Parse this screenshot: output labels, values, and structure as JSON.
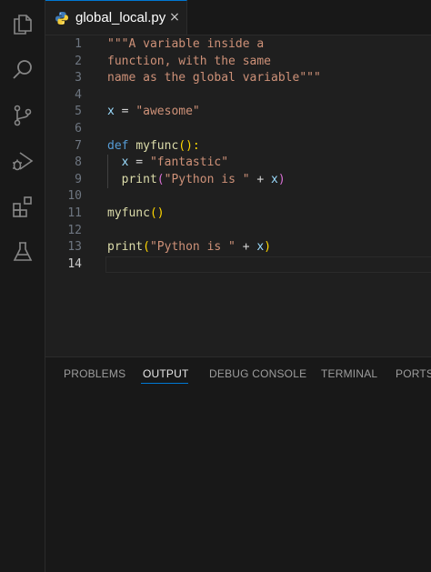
{
  "activity_bar": {
    "icons": [
      "explorer-icon",
      "search-icon",
      "source-control-icon",
      "run-debug-icon",
      "extensions-icon",
      "testing-icon"
    ]
  },
  "tab": {
    "filename": "global_local.py",
    "icon": "python-icon",
    "close": "×"
  },
  "editor": {
    "current_line": 14,
    "lines": [
      {
        "n": "1",
        "tokens": [
          {
            "t": "\"\"\"A variable inside a",
            "c": "str"
          }
        ]
      },
      {
        "n": "2",
        "tokens": [
          {
            "t": "function, with the same",
            "c": "str"
          }
        ]
      },
      {
        "n": "3",
        "tokens": [
          {
            "t": "name as the global variable\"\"\"",
            "c": "str"
          }
        ]
      },
      {
        "n": "4",
        "tokens": []
      },
      {
        "n": "5",
        "tokens": [
          {
            "t": "x",
            "c": "var"
          },
          {
            "t": " = ",
            "c": "plain"
          },
          {
            "t": "\"awesome\"",
            "c": "str"
          }
        ]
      },
      {
        "n": "6",
        "tokens": []
      },
      {
        "n": "7",
        "tokens": [
          {
            "t": "def",
            "c": "kw"
          },
          {
            "t": " ",
            "c": "plain"
          },
          {
            "t": "myfunc",
            "c": "fn"
          },
          {
            "t": "():",
            "c": "br1"
          }
        ]
      },
      {
        "n": "8",
        "tokens": [
          {
            "t": "  ",
            "c": "plain"
          },
          {
            "t": "x",
            "c": "var"
          },
          {
            "t": " = ",
            "c": "plain"
          },
          {
            "t": "\"fantastic\"",
            "c": "str"
          }
        ]
      },
      {
        "n": "9",
        "tokens": [
          {
            "t": "  ",
            "c": "plain"
          },
          {
            "t": "print",
            "c": "fn"
          },
          {
            "t": "(",
            "c": "br2"
          },
          {
            "t": "\"Python is \"",
            "c": "str"
          },
          {
            "t": " + ",
            "c": "plain"
          },
          {
            "t": "x",
            "c": "var"
          },
          {
            "t": ")",
            "c": "br2"
          }
        ]
      },
      {
        "n": "10",
        "tokens": []
      },
      {
        "n": "11",
        "tokens": [
          {
            "t": "myfunc",
            "c": "fn"
          },
          {
            "t": "()",
            "c": "br1"
          }
        ]
      },
      {
        "n": "12",
        "tokens": []
      },
      {
        "n": "13",
        "tokens": [
          {
            "t": "print",
            "c": "fn"
          },
          {
            "t": "(",
            "c": "br1"
          },
          {
            "t": "\"Python is \"",
            "c": "str"
          },
          {
            "t": " + ",
            "c": "plain"
          },
          {
            "t": "x",
            "c": "var"
          },
          {
            "t": ")",
            "c": "br1"
          }
        ]
      },
      {
        "n": "14",
        "tokens": []
      }
    ]
  },
  "panel": {
    "active_tab": "OUTPUT",
    "tabs": [
      "PROBLEMS",
      "OUTPUT",
      "DEBUG CONSOLE",
      "TERMINAL",
      "PORTS"
    ]
  },
  "colors": {
    "accent": "#0078d4",
    "string": "#ce9178",
    "keyword": "#569cd6",
    "function": "#dcdcaa",
    "variable": "#9cdcfe"
  }
}
